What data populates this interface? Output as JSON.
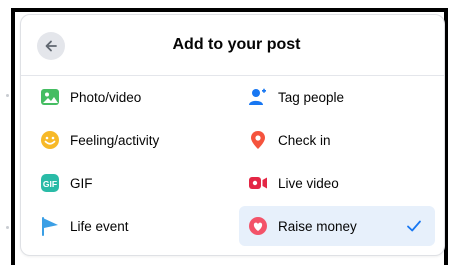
{
  "dialog": {
    "title": "Add to your post",
    "back_icon": "arrow-left-icon"
  },
  "options": [
    {
      "key": "photo_video",
      "label": "Photo/video",
      "icon": "photo-icon",
      "color": "#45bd62"
    },
    {
      "key": "tag_people",
      "label": "Tag people",
      "icon": "tag-people-icon",
      "color": "#1877f2"
    },
    {
      "key": "feeling_activity",
      "label": "Feeling/activity",
      "icon": "smiley-icon",
      "color": "#f7b928"
    },
    {
      "key": "check_in",
      "label": "Check in",
      "icon": "location-pin-icon",
      "color": "#f5533d"
    },
    {
      "key": "gif",
      "label": "GIF",
      "icon": "gif-icon",
      "color": "#2abba7"
    },
    {
      "key": "live_video",
      "label": "Live video",
      "icon": "live-video-icon",
      "color": "#e42645"
    },
    {
      "key": "life_event",
      "label": "Life event",
      "icon": "flag-icon",
      "color": "#3b9fe5"
    },
    {
      "key": "raise_money",
      "label": "Raise money",
      "icon": "raise-money-icon",
      "color": "#f35369",
      "selected": true
    }
  ],
  "colors": {
    "accent": "#1877f2",
    "selected_bg": "#e7f0fb"
  }
}
